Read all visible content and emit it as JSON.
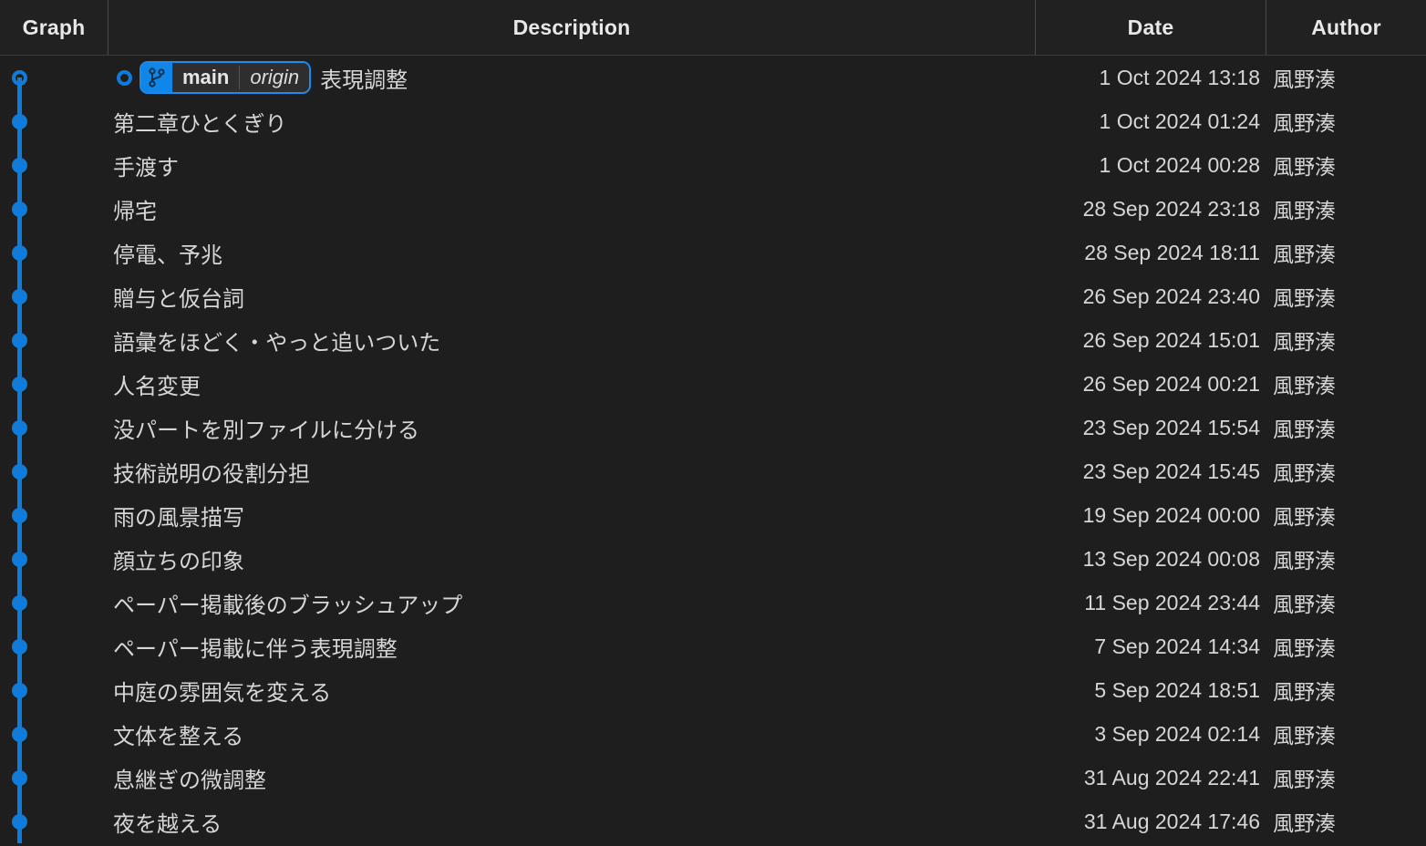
{
  "columns": {
    "graph": "Graph",
    "description": "Description",
    "date": "Date",
    "author": "Author"
  },
  "colors": {
    "accent_blue": "#0f7cdb",
    "badge_border": "#1a8cf0",
    "badge_icon_bg": "#0f86e8",
    "background": "#1e1e1e",
    "header_background": "#212121",
    "divider": "#4a4a4a",
    "text": "#d6d6d6"
  },
  "head_ref": {
    "icon": "git-branch-icon",
    "branch": "main",
    "remote": "origin"
  },
  "commits": [
    {
      "description": "表現調整",
      "date": "1 Oct 2024 13:18",
      "author": "風野湊",
      "is_head": true,
      "has_badge": true
    },
    {
      "description": "第二章ひとくぎり",
      "date": "1 Oct 2024 01:24",
      "author": "風野湊",
      "is_head": false,
      "has_badge": false
    },
    {
      "description": "手渡す",
      "date": "1 Oct 2024 00:28",
      "author": "風野湊",
      "is_head": false,
      "has_badge": false
    },
    {
      "description": "帰宅",
      "date": "28 Sep 2024 23:18",
      "author": "風野湊",
      "is_head": false,
      "has_badge": false
    },
    {
      "description": "停電、予兆",
      "date": "28 Sep 2024 18:11",
      "author": "風野湊",
      "is_head": false,
      "has_badge": false
    },
    {
      "description": "贈与と仮台詞",
      "date": "26 Sep 2024 23:40",
      "author": "風野湊",
      "is_head": false,
      "has_badge": false
    },
    {
      "description": "語彙をほどく・やっと追いついた",
      "date": "26 Sep 2024 15:01",
      "author": "風野湊",
      "is_head": false,
      "has_badge": false
    },
    {
      "description": "人名変更",
      "date": "26 Sep 2024 00:21",
      "author": "風野湊",
      "is_head": false,
      "has_badge": false
    },
    {
      "description": "没パートを別ファイルに分ける",
      "date": "23 Sep 2024 15:54",
      "author": "風野湊",
      "is_head": false,
      "has_badge": false
    },
    {
      "description": "技術説明の役割分担",
      "date": "23 Sep 2024 15:45",
      "author": "風野湊",
      "is_head": false,
      "has_badge": false
    },
    {
      "description": "雨の風景描写",
      "date": "19 Sep 2024 00:00",
      "author": "風野湊",
      "is_head": false,
      "has_badge": false
    },
    {
      "description": "顔立ちの印象",
      "date": "13 Sep 2024 00:08",
      "author": "風野湊",
      "is_head": false,
      "has_badge": false
    },
    {
      "description": "ペーパー掲載後のブラッシュアップ",
      "date": "11 Sep 2024 23:44",
      "author": "風野湊",
      "is_head": false,
      "has_badge": false
    },
    {
      "description": "ペーパー掲載に伴う表現調整",
      "date": "7 Sep 2024 14:34",
      "author": "風野湊",
      "is_head": false,
      "has_badge": false
    },
    {
      "description": "中庭の雰囲気を変える",
      "date": "5 Sep 2024 18:51",
      "author": "風野湊",
      "is_head": false,
      "has_badge": false
    },
    {
      "description": "文体を整える",
      "date": "3 Sep 2024 02:14",
      "author": "風野湊",
      "is_head": false,
      "has_badge": false
    },
    {
      "description": "息継ぎの微調整",
      "date": "31 Aug 2024 22:41",
      "author": "風野湊",
      "is_head": false,
      "has_badge": false
    },
    {
      "description": "夜を越える",
      "date": "31 Aug 2024 17:46",
      "author": "風野湊",
      "is_head": false,
      "has_badge": false
    }
  ]
}
